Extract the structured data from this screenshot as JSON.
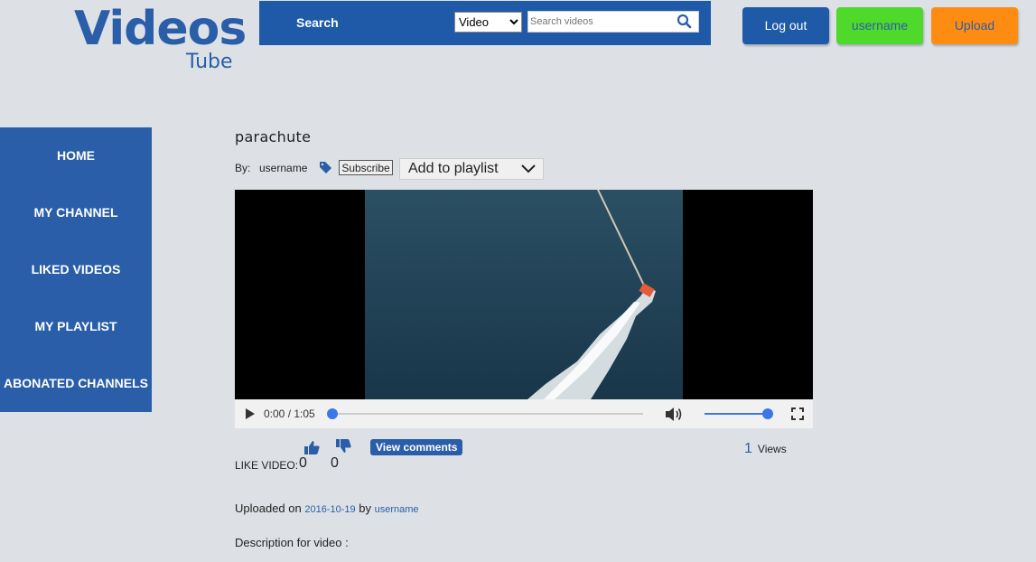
{
  "logo": {
    "main": "Videos",
    "sub": "Tube"
  },
  "search": {
    "label": "Search",
    "type_selected": "Video",
    "placeholder": "Search videos"
  },
  "top_buttons": {
    "logout": "Log out",
    "user": "username",
    "upload": "Upload"
  },
  "sidebar": {
    "items": [
      {
        "label": "HOME"
      },
      {
        "label": "MY CHANNEL"
      },
      {
        "label": "LIKED VIDEOS"
      },
      {
        "label": "MY PLAYLIST"
      },
      {
        "label": "ABONATED CHANNELS"
      }
    ]
  },
  "video": {
    "title": "parachute",
    "by_label": "By:",
    "author": "username",
    "subscribe_label": "Subscribe",
    "playlist_label": "Add to playlist"
  },
  "player": {
    "time": "0:00 / 1:05",
    "progress": 0,
    "volume": 1
  },
  "stats": {
    "like_label": "LIKE VIDEO:",
    "likes": "0",
    "dislikes": "0",
    "view_comments_label": "View comments",
    "views_count": "1",
    "views_label": "Views"
  },
  "upload_info": {
    "prefix": "Uploaded on",
    "date": "2016-10-19",
    "by": "by",
    "user": "username",
    "description_label": "Description for video :"
  },
  "colors": {
    "brand": "#2a5ea8",
    "user_btn": "#4fd92a",
    "upload_btn": "#ff8c12"
  }
}
